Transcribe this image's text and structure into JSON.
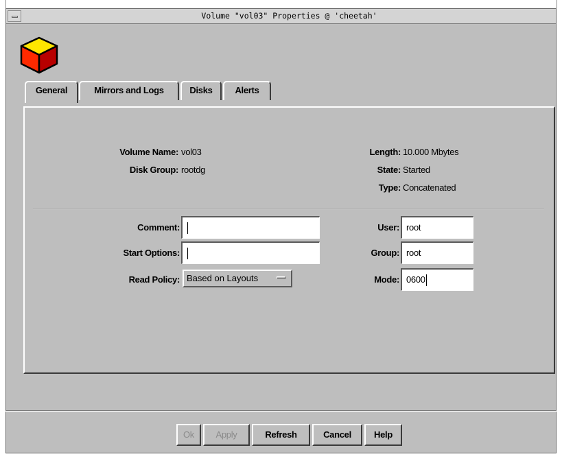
{
  "window": {
    "title": "Volume \"vol03\" Properties @ 'cheetah'"
  },
  "tabs": [
    "General",
    "Mirrors and Logs",
    "Disks",
    "Alerts"
  ],
  "info": {
    "volume_name_label": "Volume Name:",
    "volume_name_value": "vol03",
    "disk_group_label": "Disk Group:",
    "disk_group_value": "rootdg",
    "length_label": "Length:",
    "length_value": "10.000 Mbytes",
    "state_label": "State:",
    "state_value": "Started",
    "type_label": "Type:",
    "type_value": "Concatenated"
  },
  "form": {
    "comment_label": "Comment:",
    "comment_value": "",
    "start_options_label": "Start Options:",
    "start_options_value": "",
    "read_policy_label": "Read Policy:",
    "read_policy_value": "Based on Layouts",
    "user_label": "User:",
    "user_value": "root",
    "group_label": "Group:",
    "group_value": "root",
    "mode_label": "Mode:",
    "mode_value": "0600"
  },
  "buttons": {
    "ok": "Ok",
    "apply": "Apply",
    "refresh": "Refresh",
    "cancel": "Cancel",
    "help": "Help"
  },
  "colors": {
    "background": "#bebebe",
    "cube_top": "#ffe600",
    "cube_left": "#ff2a00",
    "cube_right": "#b80000"
  },
  "icons": [
    "volume-cube-icon",
    "window-menu-icon",
    "option-menu-indicator-icon"
  ]
}
